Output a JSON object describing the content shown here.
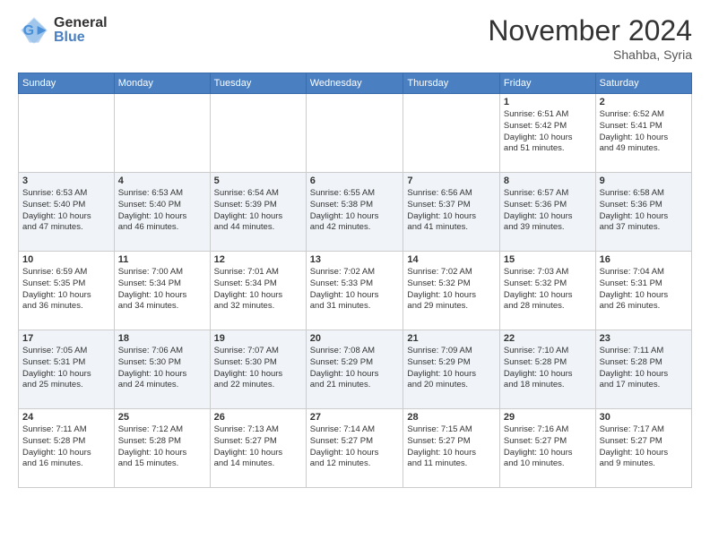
{
  "header": {
    "logo_line1": "General",
    "logo_line2": "Blue",
    "month": "November 2024",
    "location": "Shahba, Syria"
  },
  "weekdays": [
    "Sunday",
    "Monday",
    "Tuesday",
    "Wednesday",
    "Thursday",
    "Friday",
    "Saturday"
  ],
  "weeks": [
    [
      {
        "day": "",
        "info": ""
      },
      {
        "day": "",
        "info": ""
      },
      {
        "day": "",
        "info": ""
      },
      {
        "day": "",
        "info": ""
      },
      {
        "day": "",
        "info": ""
      },
      {
        "day": "1",
        "info": "Sunrise: 6:51 AM\nSunset: 5:42 PM\nDaylight: 10 hours\nand 51 minutes."
      },
      {
        "day": "2",
        "info": "Sunrise: 6:52 AM\nSunset: 5:41 PM\nDaylight: 10 hours\nand 49 minutes."
      }
    ],
    [
      {
        "day": "3",
        "info": "Sunrise: 6:53 AM\nSunset: 5:40 PM\nDaylight: 10 hours\nand 47 minutes."
      },
      {
        "day": "4",
        "info": "Sunrise: 6:53 AM\nSunset: 5:40 PM\nDaylight: 10 hours\nand 46 minutes."
      },
      {
        "day": "5",
        "info": "Sunrise: 6:54 AM\nSunset: 5:39 PM\nDaylight: 10 hours\nand 44 minutes."
      },
      {
        "day": "6",
        "info": "Sunrise: 6:55 AM\nSunset: 5:38 PM\nDaylight: 10 hours\nand 42 minutes."
      },
      {
        "day": "7",
        "info": "Sunrise: 6:56 AM\nSunset: 5:37 PM\nDaylight: 10 hours\nand 41 minutes."
      },
      {
        "day": "8",
        "info": "Sunrise: 6:57 AM\nSunset: 5:36 PM\nDaylight: 10 hours\nand 39 minutes."
      },
      {
        "day": "9",
        "info": "Sunrise: 6:58 AM\nSunset: 5:36 PM\nDaylight: 10 hours\nand 37 minutes."
      }
    ],
    [
      {
        "day": "10",
        "info": "Sunrise: 6:59 AM\nSunset: 5:35 PM\nDaylight: 10 hours\nand 36 minutes."
      },
      {
        "day": "11",
        "info": "Sunrise: 7:00 AM\nSunset: 5:34 PM\nDaylight: 10 hours\nand 34 minutes."
      },
      {
        "day": "12",
        "info": "Sunrise: 7:01 AM\nSunset: 5:34 PM\nDaylight: 10 hours\nand 32 minutes."
      },
      {
        "day": "13",
        "info": "Sunrise: 7:02 AM\nSunset: 5:33 PM\nDaylight: 10 hours\nand 31 minutes."
      },
      {
        "day": "14",
        "info": "Sunrise: 7:02 AM\nSunset: 5:32 PM\nDaylight: 10 hours\nand 29 minutes."
      },
      {
        "day": "15",
        "info": "Sunrise: 7:03 AM\nSunset: 5:32 PM\nDaylight: 10 hours\nand 28 minutes."
      },
      {
        "day": "16",
        "info": "Sunrise: 7:04 AM\nSunset: 5:31 PM\nDaylight: 10 hours\nand 26 minutes."
      }
    ],
    [
      {
        "day": "17",
        "info": "Sunrise: 7:05 AM\nSunset: 5:31 PM\nDaylight: 10 hours\nand 25 minutes."
      },
      {
        "day": "18",
        "info": "Sunrise: 7:06 AM\nSunset: 5:30 PM\nDaylight: 10 hours\nand 24 minutes."
      },
      {
        "day": "19",
        "info": "Sunrise: 7:07 AM\nSunset: 5:30 PM\nDaylight: 10 hours\nand 22 minutes."
      },
      {
        "day": "20",
        "info": "Sunrise: 7:08 AM\nSunset: 5:29 PM\nDaylight: 10 hours\nand 21 minutes."
      },
      {
        "day": "21",
        "info": "Sunrise: 7:09 AM\nSunset: 5:29 PM\nDaylight: 10 hours\nand 20 minutes."
      },
      {
        "day": "22",
        "info": "Sunrise: 7:10 AM\nSunset: 5:28 PM\nDaylight: 10 hours\nand 18 minutes."
      },
      {
        "day": "23",
        "info": "Sunrise: 7:11 AM\nSunset: 5:28 PM\nDaylight: 10 hours\nand 17 minutes."
      }
    ],
    [
      {
        "day": "24",
        "info": "Sunrise: 7:11 AM\nSunset: 5:28 PM\nDaylight: 10 hours\nand 16 minutes."
      },
      {
        "day": "25",
        "info": "Sunrise: 7:12 AM\nSunset: 5:28 PM\nDaylight: 10 hours\nand 15 minutes."
      },
      {
        "day": "26",
        "info": "Sunrise: 7:13 AM\nSunset: 5:27 PM\nDaylight: 10 hours\nand 14 minutes."
      },
      {
        "day": "27",
        "info": "Sunrise: 7:14 AM\nSunset: 5:27 PM\nDaylight: 10 hours\nand 12 minutes."
      },
      {
        "day": "28",
        "info": "Sunrise: 7:15 AM\nSunset: 5:27 PM\nDaylight: 10 hours\nand 11 minutes."
      },
      {
        "day": "29",
        "info": "Sunrise: 7:16 AM\nSunset: 5:27 PM\nDaylight: 10 hours\nand 10 minutes."
      },
      {
        "day": "30",
        "info": "Sunrise: 7:17 AM\nSunset: 5:27 PM\nDaylight: 10 hours\nand 9 minutes."
      }
    ]
  ]
}
